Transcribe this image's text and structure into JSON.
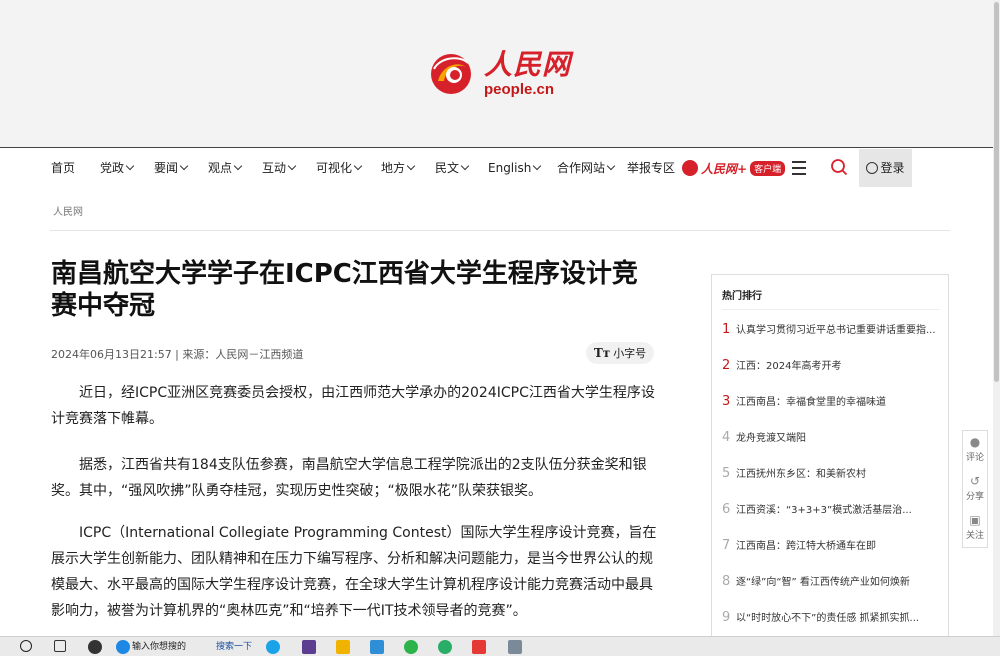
{
  "header": {
    "logo_cn": "人民网",
    "logo_en": "people.cn",
    "colors": {
      "brand_red": "#d6202a",
      "logo_orange": "#f5a300"
    }
  },
  "nav": {
    "items": [
      {
        "label": "首页",
        "has_menu": false
      },
      {
        "label": "党政",
        "has_menu": true
      },
      {
        "label": "要闻",
        "has_menu": true
      },
      {
        "label": "观点",
        "has_menu": true
      },
      {
        "label": "互动",
        "has_menu": true
      },
      {
        "label": "可视化",
        "has_menu": true
      },
      {
        "label": "地方",
        "has_menu": true
      },
      {
        "label": "民文",
        "has_menu": true
      },
      {
        "label": "English",
        "has_menu": true
      },
      {
        "label": "合作网站",
        "has_menu": true
      },
      {
        "label": "举报专区",
        "has_menu": false
      }
    ],
    "app_name": "人民网+",
    "app_badge": "客户端",
    "menu_icon": "hamburger-icon",
    "search_icon": "search-icon",
    "login_label": "登录"
  },
  "breadcrumb": "人民网",
  "article": {
    "title": "南昌航空大学学子在ICPC江西省大学生程序设计竞赛中夺冠",
    "meta": "2024年06月13日21:57 | 来源：人民网－江西频道",
    "font_toggle": {
      "icon": "Tт",
      "label": "小字号"
    },
    "paragraphs": [
      "近日，经ICPC亚洲区竞赛委员会授权，由江西师范大学承办的2024ICPC江西省大学生程序设计竞赛落下帷幕。",
      "据悉，江西省共有184支队伍参赛，南昌航空大学信息工程学院派出的2支队伍分获金奖和银奖。其中，“强风吹拂”队勇夺桂冠，实现历史性突破；“极限水花”队荣获银奖。",
      "ICPC（International Collegiate Programming Contest）国际大学生程序设计竞赛，旨在展示大学生创新能力、团队精神和在压力下编写程序、分析和解决问题能力，是当今世界公认的规模最大、水平最高的国际大学生程序设计竞赛，在全球大学生计算机程序设计能力竞赛活动中最具影响力，被誉为计算机界的“奥林匹克”和“培养下一代IT技术领导者的竞赛”。"
    ]
  },
  "hot": {
    "heading": "热门排行",
    "items": [
      {
        "num": "1",
        "text": "认真学习贯彻习近平总书记重要讲话重要指..."
      },
      {
        "num": "2",
        "text": "江西：2024年高考开考"
      },
      {
        "num": "3",
        "text": "江西南昌：幸福食堂里的幸福味道"
      },
      {
        "num": "4",
        "text": "龙舟竞渡又端阳"
      },
      {
        "num": "5",
        "text": "江西抚州东乡区：和美新农村"
      },
      {
        "num": "6",
        "text": "江西资溪：“3+3+3”模式激活基层治..."
      },
      {
        "num": "7",
        "text": "江西南昌：跨江特大桥通车在即"
      },
      {
        "num": "8",
        "text": "逐“绿”向“智” 看江西传统产业如何焕新"
      },
      {
        "num": "9",
        "text": "以“时时放心不下”的责任感 抓紧抓实抓..."
      }
    ]
  },
  "side": {
    "comment": "评论",
    "share": "分享",
    "follow": "关注"
  },
  "taskbar": {
    "search_placeholder": "输入你想搜的",
    "search_button": "搜索一下"
  }
}
